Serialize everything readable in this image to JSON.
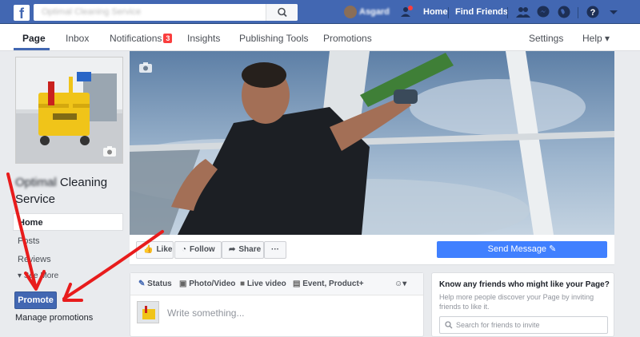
{
  "topbar": {
    "search_placeholder": "Optimal Cleaning Service",
    "user_name": "Asgard",
    "friend_request_badge": "",
    "home_label": "Home",
    "find_friends_label": "Find Friends",
    "icons": [
      "facebook-logo-icon",
      "search-icon",
      "friend-requests-icon",
      "messenger-icon",
      "globe-icon",
      "help-icon",
      "caret-down-icon"
    ]
  },
  "page_nav": {
    "tabs": [
      {
        "label": "Page"
      },
      {
        "label": "Inbox"
      },
      {
        "label": "Notifications",
        "badge": "3"
      },
      {
        "label": "Insights"
      },
      {
        "label": "Publishing Tools"
      },
      {
        "label": "Promotions"
      }
    ],
    "settings_label": "Settings",
    "help_label": "Help ▾"
  },
  "left": {
    "page_name_blurred": "Optimal",
    "page_name_rest": " Cleaning Service",
    "nav": [
      {
        "label": "Home"
      },
      {
        "label": "Posts"
      },
      {
        "label": "Reviews"
      },
      {
        "label": "▾ See More"
      }
    ],
    "promote_label": "Promote",
    "manage_label": "Manage promotions"
  },
  "actions": {
    "like": "Like",
    "follow": "Follow",
    "share": "Share",
    "more": "···",
    "send_message": "Send Message ✎"
  },
  "composer": {
    "tabs": [
      "Status",
      "Photo/Video",
      "Live video",
      "Event, Product+"
    ],
    "placeholder": "Write something..."
  },
  "invite": {
    "title": "Know any friends who might like your Page?",
    "description": "Help more people discover your Page by inviting friends to like it.",
    "search_placeholder": "Search for friends to invite"
  },
  "colors": {
    "brand_blue": "#4267b2",
    "send_blue": "#4080ff",
    "annotation_red": "#e81c1c"
  }
}
